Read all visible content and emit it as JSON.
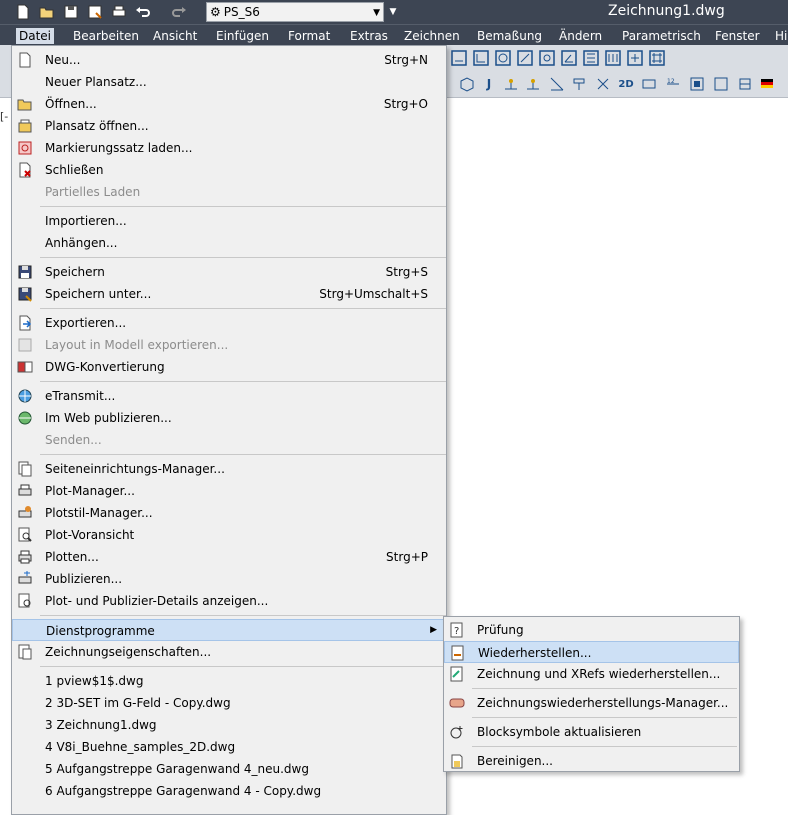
{
  "window": {
    "title": "Zeichnung1.dwg",
    "workspace": "PS_S6"
  },
  "quick_access": [
    {
      "icon": "new-icon"
    },
    {
      "icon": "open-icon"
    },
    {
      "icon": "save-icon"
    },
    {
      "icon": "save-as-icon"
    },
    {
      "icon": "print-icon"
    },
    {
      "icon": "undo-icon"
    },
    {
      "icon": "redo-icon"
    }
  ],
  "menubar": {
    "items": [
      {
        "label": "Datei"
      },
      {
        "label": "Bearbeiten"
      },
      {
        "label": "Ansicht"
      },
      {
        "label": "Einfügen"
      },
      {
        "label": "Format"
      },
      {
        "label": "Extras"
      },
      {
        "label": "Zeichnen"
      },
      {
        "label": "Bemaßung"
      },
      {
        "label": "Ändern"
      },
      {
        "label": "Parametrisch"
      },
      {
        "label": "Fenster"
      },
      {
        "label": "Hilfe"
      }
    ]
  },
  "toolbar2": {
    "labels": [
      "J",
      "2D",
      "2D"
    ]
  },
  "canvas": {
    "viewport_label": "[-"
  },
  "file_menu": {
    "items": [
      {
        "label": "Neu...",
        "shortcut": "Strg+N",
        "disabled": false,
        "icon": "new-file-icon"
      },
      {
        "label": "Neuer Plansatz...",
        "shortcut": "",
        "disabled": false,
        "icon": ""
      },
      {
        "label": "Öffnen...",
        "shortcut": "Strg+O",
        "disabled": false,
        "icon": "open-folder-icon"
      },
      {
        "label": "Plansatz öffnen...",
        "shortcut": "",
        "disabled": false,
        "icon": "open-sheetset-icon"
      },
      {
        "label": "Markierungssatz laden...",
        "shortcut": "",
        "disabled": false,
        "icon": "markup-icon"
      },
      {
        "label": "Schließen",
        "shortcut": "",
        "disabled": false,
        "icon": "close-file-icon"
      },
      {
        "label": "Partielles Laden",
        "shortcut": "",
        "disabled": true,
        "icon": ""
      },
      {
        "label": "Importieren...",
        "shortcut": "",
        "disabled": false,
        "icon": ""
      },
      {
        "label": "Anhängen...",
        "shortcut": "",
        "disabled": false,
        "icon": ""
      },
      {
        "label": "Speichern",
        "shortcut": "Strg+S",
        "disabled": false,
        "icon": "save-icon"
      },
      {
        "label": "Speichern unter...",
        "shortcut": "Strg+Umschalt+S",
        "disabled": false,
        "icon": "save-as-icon"
      },
      {
        "label": "Exportieren...",
        "shortcut": "",
        "disabled": false,
        "icon": "export-icon"
      },
      {
        "label": "Layout in Modell exportieren...",
        "shortcut": "",
        "disabled": true,
        "icon": "layout-export-icon"
      },
      {
        "label": "DWG-Konvertierung",
        "shortcut": "",
        "disabled": false,
        "icon": "dwg-convert-icon"
      },
      {
        "label": "eTransmit...",
        "shortcut": "",
        "disabled": false,
        "icon": "etransmit-icon"
      },
      {
        "label": "Im Web publizieren...",
        "shortcut": "",
        "disabled": false,
        "icon": "web-publish-icon"
      },
      {
        "label": "Senden...",
        "shortcut": "",
        "disabled": true,
        "icon": ""
      },
      {
        "label": "Seiteneinrichtungs-Manager...",
        "shortcut": "",
        "disabled": false,
        "icon": "page-setup-icon"
      },
      {
        "label": "Plot-Manager...",
        "shortcut": "",
        "disabled": false,
        "icon": "plotter-icon"
      },
      {
        "label": "Plotstil-Manager...",
        "shortcut": "",
        "disabled": false,
        "icon": "plotstyle-icon"
      },
      {
        "label": "Plot-Voransicht",
        "shortcut": "",
        "disabled": false,
        "icon": "preview-icon"
      },
      {
        "label": "Plotten...",
        "shortcut": "Strg+P",
        "disabled": false,
        "icon": "plot-icon"
      },
      {
        "label": "Publizieren...",
        "shortcut": "",
        "disabled": false,
        "icon": "publish-icon"
      },
      {
        "label": "Plot- und Publizier-Details anzeigen...",
        "shortcut": "",
        "disabled": false,
        "icon": "plot-details-icon"
      },
      {
        "label": "Dienstprogramme",
        "shortcut": "",
        "disabled": false,
        "icon": "",
        "submenu": true
      },
      {
        "label": "Zeichnungseigenschaften...",
        "shortcut": "",
        "disabled": false,
        "icon": "properties-icon"
      },
      {
        "label": "1 pview$1$.dwg",
        "shortcut": "",
        "disabled": false,
        "icon": ""
      },
      {
        "label": "2 3D-SET im G-Feld - Copy.dwg",
        "shortcut": "",
        "disabled": false,
        "icon": ""
      },
      {
        "label": "3 Zeichnung1.dwg",
        "shortcut": "",
        "disabled": false,
        "icon": ""
      },
      {
        "label": "4 V8i_Buehne_samples_2D.dwg",
        "shortcut": "",
        "disabled": false,
        "icon": ""
      },
      {
        "label": "5 Aufgangstreppe Garagenwand 4_neu.dwg",
        "shortcut": "",
        "disabled": false,
        "icon": ""
      },
      {
        "label": "6 Aufgangstreppe Garagenwand 4 - Copy.dwg",
        "shortcut": "",
        "disabled": false,
        "icon": ""
      }
    ]
  },
  "utilities_submenu": {
    "items": [
      {
        "label": "Prüfung",
        "icon": "audit-icon"
      },
      {
        "label": "Wiederherstellen...",
        "icon": "recover-icon"
      },
      {
        "label": "Zeichnung und XRefs wiederherstellen...",
        "icon": "recover-xrefs-icon"
      },
      {
        "label": "Zeichnungswiederherstellungs-Manager...",
        "icon": "recovery-manager-icon"
      },
      {
        "label": "Blocksymbole aktualisieren",
        "icon": "block-icons-icon"
      },
      {
        "label": "Bereinigen...",
        "icon": "purge-icon"
      }
    ]
  },
  "colors": {
    "titlebar": "#3d4553",
    "menu_bg": "#f0f0f0",
    "highlight": "#cde0f5",
    "disabled_text": "#8c8c8c"
  }
}
